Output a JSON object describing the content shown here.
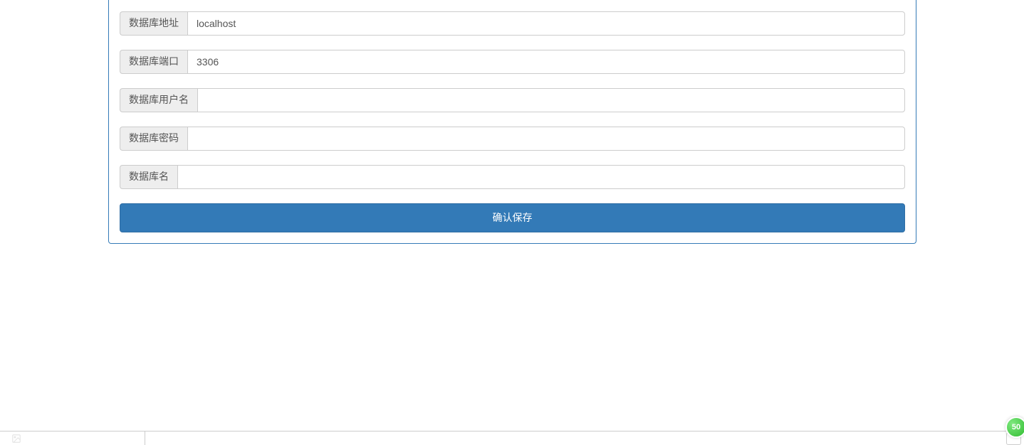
{
  "form": {
    "fields": {
      "db_address": {
        "label": "数据库地址",
        "value": "localhost"
      },
      "db_port": {
        "label": "数据库端口",
        "value": "3306"
      },
      "db_username": {
        "label": "数据库用户名",
        "value": ""
      },
      "db_password": {
        "label": "数据库密码",
        "value": ""
      },
      "db_name": {
        "label": "数据库名",
        "value": ""
      }
    },
    "submit_label": "确认保存"
  },
  "badge": {
    "value": "50"
  }
}
